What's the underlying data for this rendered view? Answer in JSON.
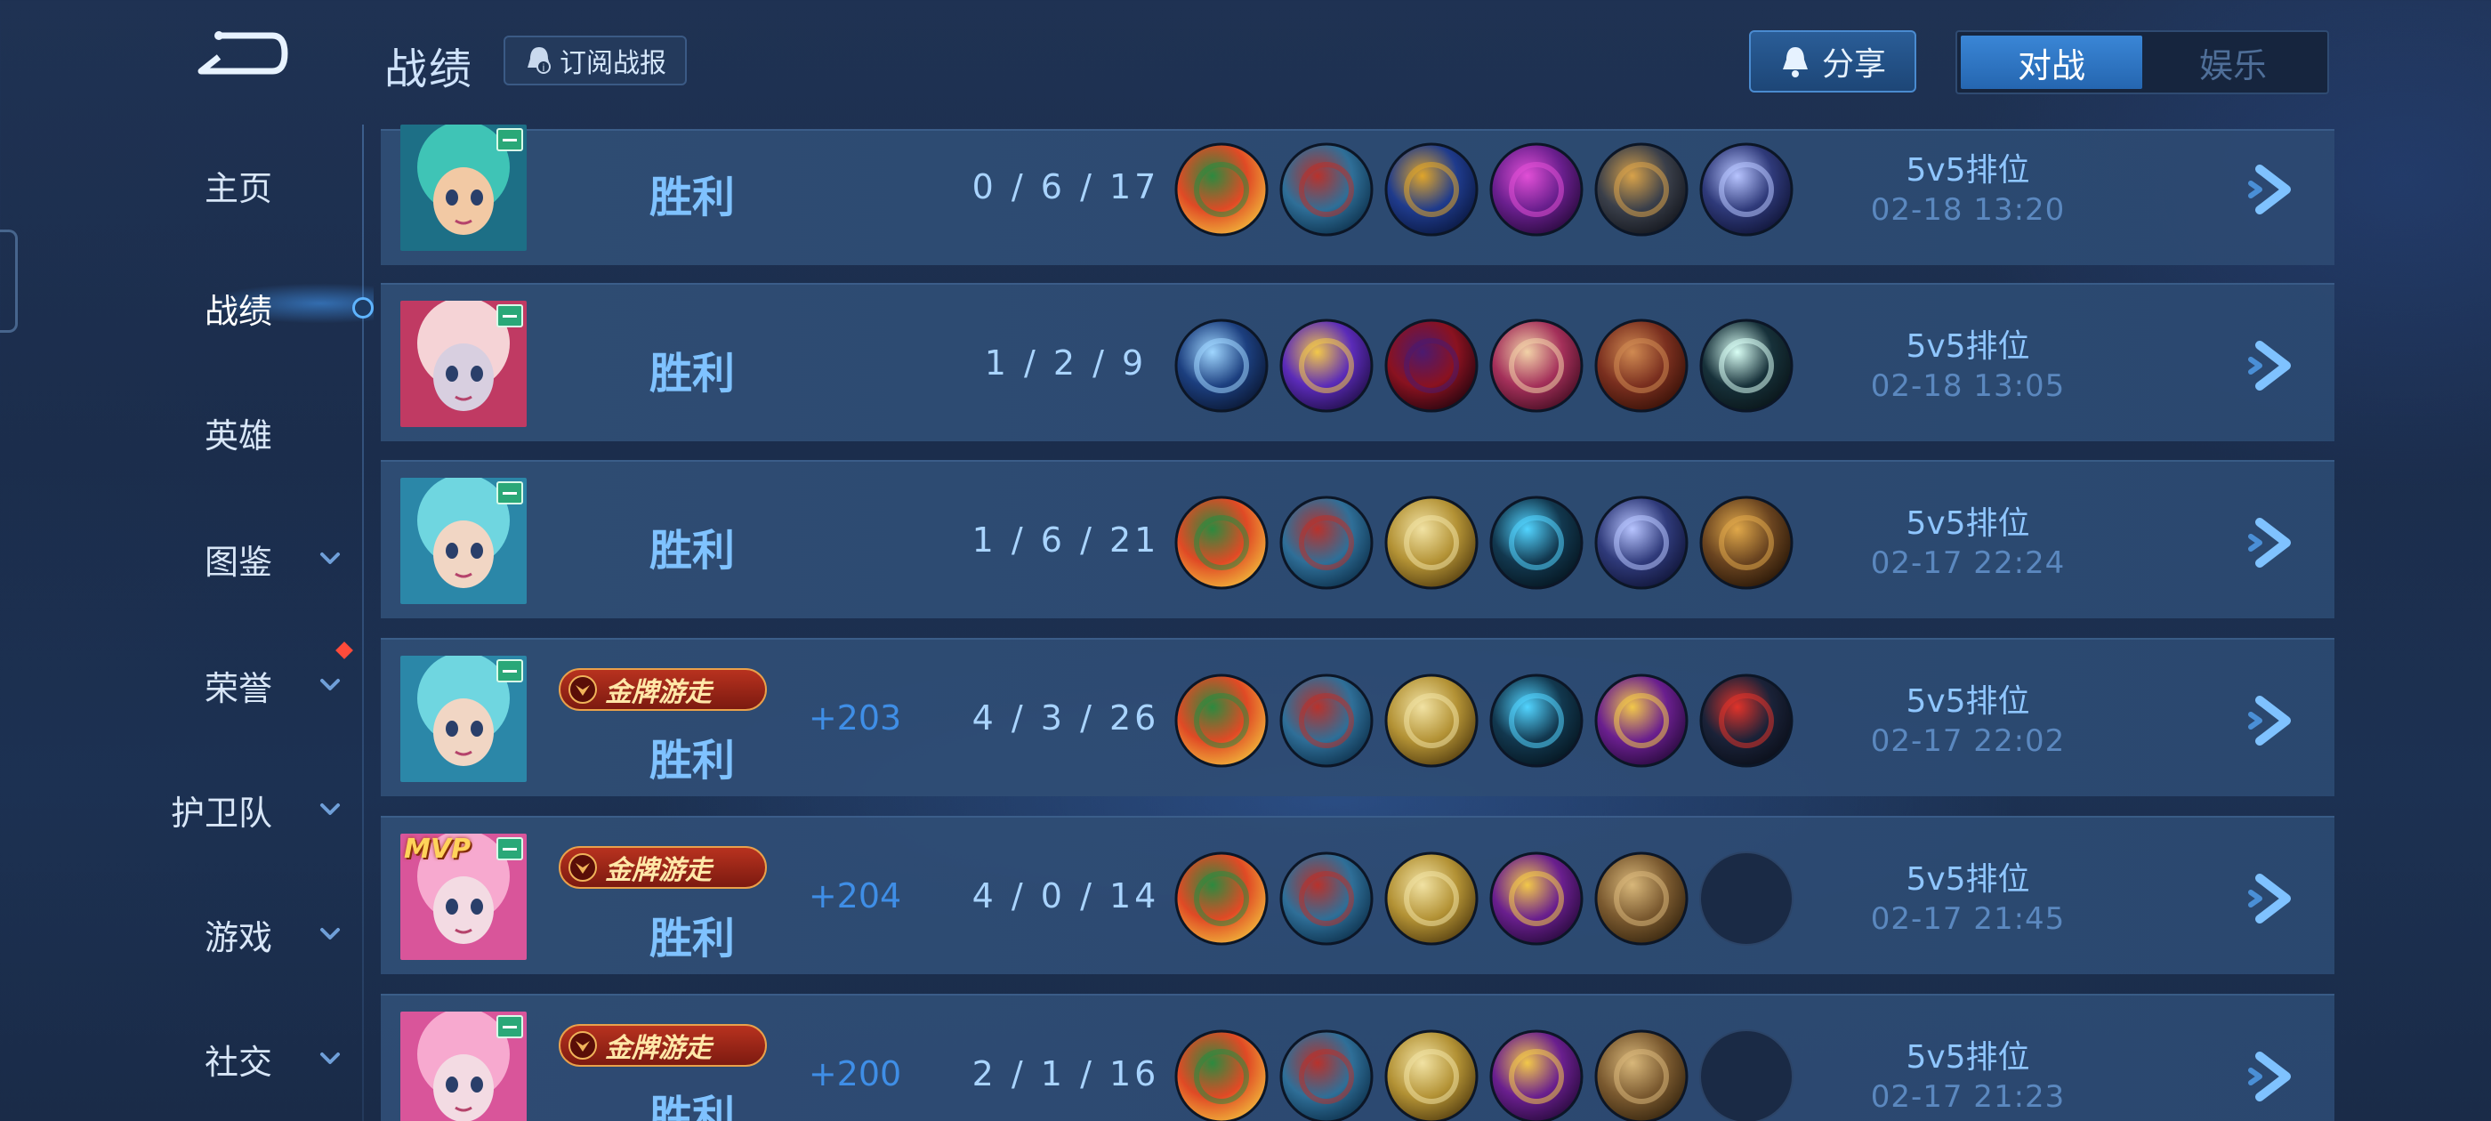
{
  "header": {
    "title": "战绩",
    "subscribe_label": "订阅战报",
    "share_label": "分享",
    "tabs": [
      {
        "label": "对战",
        "active": true
      },
      {
        "label": "娱乐",
        "active": false
      }
    ]
  },
  "sidebar": {
    "items": [
      {
        "label": "主页",
        "active": false,
        "chevron": false
      },
      {
        "label": "战绩",
        "active": true,
        "chevron": false
      },
      {
        "label": "英雄",
        "active": false,
        "chevron": false
      },
      {
        "label": "图鉴",
        "active": false,
        "chevron": true
      },
      {
        "label": "荣誉",
        "active": false,
        "chevron": true
      },
      {
        "label": "护卫队",
        "active": false,
        "chevron": true
      },
      {
        "label": "游戏",
        "active": false,
        "chevron": true
      },
      {
        "label": "社交",
        "active": false,
        "chevron": true
      }
    ]
  },
  "matches": [
    {
      "result": "胜利",
      "kda": "0 / 6 / 17",
      "points": "",
      "badge": "",
      "mvp": false,
      "mode": "5v5排位",
      "time": "02-18  13:20",
      "avatar_colors": [
        "#3fc4b6",
        "#1d6f86",
        "#f2c9a4"
      ],
      "items": [
        "serpent-emblem-icon",
        "red-boots-icon",
        "golden-chalice-icon",
        "purple-staff-icon",
        "horned-armor-icon",
        "dark-cloak-icon"
      ]
    },
    {
      "result": "胜利",
      "kda": "1 / 2 / 9",
      "points": "",
      "badge": "",
      "mvp": false,
      "mode": "5v5排位",
      "time": "02-18  13:05",
      "avatar_colors": [
        "#f5d3d6",
        "#c03a63",
        "#d8cfe0"
      ],
      "items": [
        "blue-boots-icon",
        "purple-wing-staff-icon",
        "crimson-hat-icon",
        "scroll-tome-icon",
        "red-book-icon",
        "white-feather-icon"
      ]
    },
    {
      "result": "胜利",
      "kda": "1 / 6 / 21",
      "points": "",
      "badge": "",
      "mvp": false,
      "mode": "5v5排位",
      "time": "02-17  22:24",
      "avatar_colors": [
        "#6fd6e0",
        "#2b87a8",
        "#f1d6c4"
      ],
      "items": [
        "serpent-emblem-icon",
        "red-boots-icon",
        "golden-gauntlet-icon",
        "blue-scythe-icon",
        "dark-cloak-icon",
        "bronze-armor-icon"
      ]
    },
    {
      "result": "胜利",
      "kda": "4 / 3 / 26",
      "points": "+203",
      "badge": "金牌游走",
      "mvp": false,
      "mode": "5v5排位",
      "time": "02-17  22:02",
      "avatar_colors": [
        "#6fd6e0",
        "#2b87a8",
        "#f1d6c4"
      ],
      "items": [
        "serpent-emblem-icon",
        "red-boots-icon",
        "golden-gauntlet-icon",
        "blue-scythe-icon",
        "gold-purple-scepter-icon",
        "red-gem-icon"
      ]
    },
    {
      "result": "胜利",
      "kda": "4 / 0 / 14",
      "points": "+204",
      "badge": "金牌游走",
      "mvp": true,
      "mode": "5v5排位",
      "time": "02-17  21:45",
      "avatar_colors": [
        "#f7a9cf",
        "#d9559a",
        "#f3dbe3"
      ],
      "items": [
        "serpent-emblem-icon",
        "red-boots-icon",
        "golden-gauntlet-icon",
        "gold-purple-scepter-icon",
        "wooden-crate-icon",
        "empty-slot"
      ]
    },
    {
      "result": "胜利",
      "kda": "2 / 1 / 16",
      "points": "+200",
      "badge": "金牌游走",
      "mvp": false,
      "mode": "5v5排位",
      "time": "02-17  21:23",
      "avatar_colors": [
        "#f7a9cf",
        "#d9559a",
        "#f3dbe3"
      ],
      "items": [
        "serpent-emblem-icon",
        "red-boots-icon",
        "golden-gauntlet-icon",
        "gold-purple-scepter-icon",
        "wooden-crate-icon",
        "empty-slot"
      ]
    }
  ],
  "mvp_label": "MVP",
  "item_palette": {
    "serpent-emblem-icon": [
      "#e04a25",
      "#2c8a3f",
      "#f0b33a"
    ],
    "red-boots-icon": [
      "#2f6f98",
      "#b8322c",
      "#0f3450"
    ],
    "golden-chalice-icon": [
      "#1f3b8c",
      "#e0a52a",
      "#0b1a45"
    ],
    "purple-staff-icon": [
      "#6a1f8e",
      "#e14fd6",
      "#2b0b40"
    ],
    "horned-armor-icon": [
      "#3a3f4a",
      "#d8a24a",
      "#15181f"
    ],
    "dark-cloak-icon": [
      "#2f3a7a",
      "#b7c4ff",
      "#11163a"
    ],
    "blue-boots-icon": [
      "#1c3f7f",
      "#9fd6ff",
      "#0b1936"
    ],
    "purple-wing-staff-icon": [
      "#5b2bb8",
      "#f2c84a",
      "#24104f"
    ],
    "crimson-hat-icon": [
      "#8a1220",
      "#4b1a70",
      "#2a0610"
    ],
    "scroll-tome-icon": [
      "#a4305a",
      "#f2d2a8",
      "#4a0f25"
    ],
    "red-book-icon": [
      "#7a2f1f",
      "#d08a52",
      "#3a1208"
    ],
    "white-feather-icon": [
      "#17313a",
      "#d9fff5",
      "#0a161a"
    ],
    "golden-gauntlet-icon": [
      "#b39235",
      "#f1e2a3",
      "#5a4312"
    ],
    "blue-scythe-icon": [
      "#12384f",
      "#52d4ff",
      "#061722"
    ],
    "bronze-armor-icon": [
      "#6a4420",
      "#e0a84a",
      "#2a1808"
    ],
    "gold-purple-scepter-icon": [
      "#6a1f8e",
      "#f2c84a",
      "#2b0b40"
    ],
    "red-gem-icon": [
      "#1a2238",
      "#e0332a",
      "#0b0f1a"
    ],
    "wooden-crate-icon": [
      "#7b5a30",
      "#d8b77a",
      "#3a2810"
    ]
  }
}
